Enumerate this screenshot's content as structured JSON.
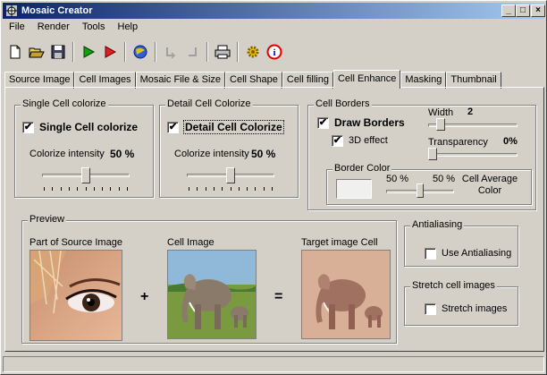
{
  "window": {
    "title": "Mosaic Creator"
  },
  "menu": [
    "File",
    "Render",
    "Tools",
    "Help"
  ],
  "toolbar_icons": [
    "new-file-icon",
    "open-folder-icon",
    "save-icon",
    "run-icon",
    "run-red-icon",
    "globe-icon",
    "undo-icon",
    "redo-icon",
    "print-icon",
    "settings-gear-icon",
    "info-icon"
  ],
  "tabs": [
    "Source Image",
    "Cell Images",
    "Mosaic File & Size",
    "Cell Shape",
    "Cell filling",
    "Cell Enhance",
    "Masking",
    "Thumbnail"
  ],
  "active_tab": "Cell Enhance",
  "single_cell": {
    "group_title": "Single Cell colorize",
    "checkbox_label": "Single Cell colorize",
    "checked": true,
    "intensity_label": "Colorize intensity",
    "intensity_value": "50 %",
    "slider_level": 0.5
  },
  "detail_cell": {
    "group_title": "Detail Cell Colorize",
    "checkbox_label": "Detail Cell Colorize",
    "checked": true,
    "intensity_label": "Colorize intensity",
    "intensity_value": "50 %",
    "slider_level": 0.5
  },
  "cell_borders": {
    "group_title": "Cell Borders",
    "draw_borders_label": "Draw Borders",
    "draw_borders_checked": true,
    "three_d_label": "3D effect",
    "three_d_checked": true,
    "width_label": "Width",
    "width_value": "2",
    "width_level": 0.1,
    "transparency_label": "Transparency",
    "transparency_value": "0%",
    "transparency_level": 0.0,
    "border_color_title": "Border Color",
    "left_pct": "50 %",
    "right_pct": "50 %",
    "mix_level": 0.5,
    "cell_average_label": "Cell Average Color",
    "swatch_color": "#f0f0ee"
  },
  "preview": {
    "group_title": "Preview",
    "source_label": "Part of Source Image",
    "cell_label": "Cell Image",
    "target_label": "Target image Cell",
    "plus": "+",
    "equals": "="
  },
  "antialiasing": {
    "group_title": "Antialiasing",
    "label": "Use Antialiasing",
    "checked": false
  },
  "stretch": {
    "group_title": "Stretch cell images",
    "label": "Stretch images",
    "checked": false
  },
  "check_mark": "✔",
  "title_buttons": {
    "minimize": "_",
    "maximize": "□",
    "close": "×"
  }
}
